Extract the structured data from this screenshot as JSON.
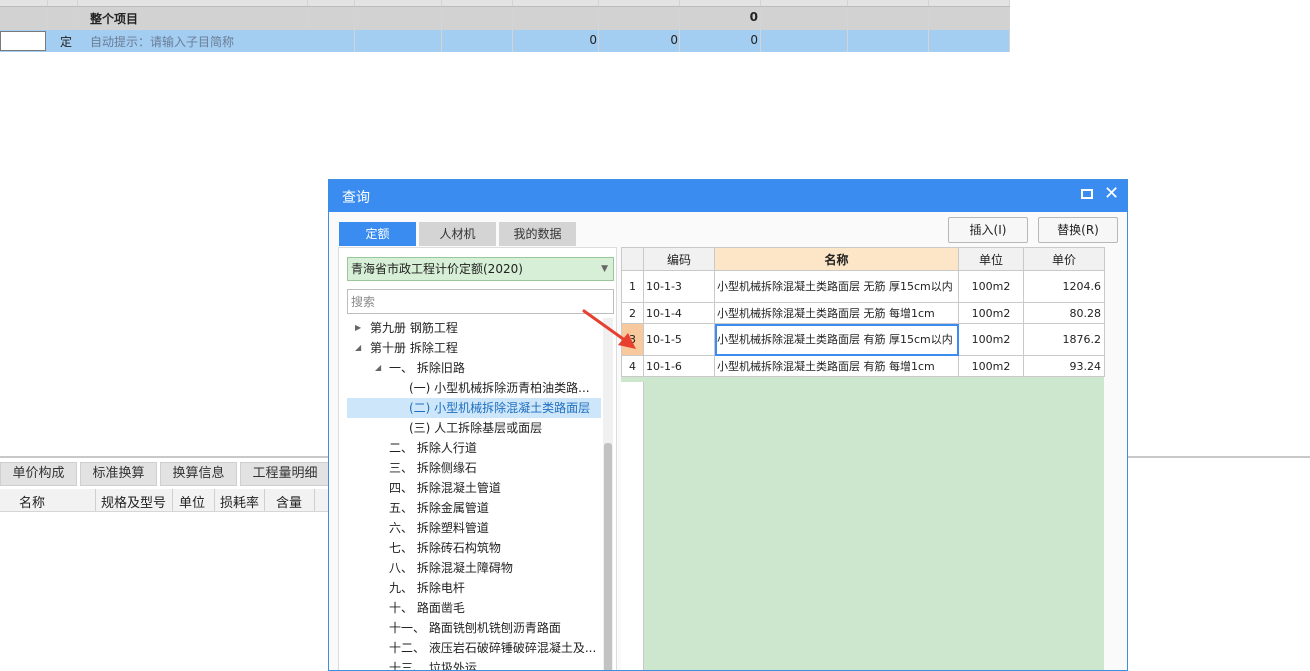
{
  "main_grid": {
    "total_row": {
      "label": "整个项目",
      "value": "0"
    },
    "input_row": {
      "type": "定",
      "hint": "自动提示：请输入子目简称",
      "v1": "0",
      "v2": "0",
      "v3": "0"
    }
  },
  "bottom_panel": {
    "tabs": [
      "单价构成",
      "标准换算",
      "换算信息",
      "工程量明细"
    ],
    "columns": [
      "名称",
      "规格及型号",
      "单位",
      "损耗率",
      "含量"
    ]
  },
  "dialog": {
    "title": "查询",
    "tabs": [
      "定额",
      "人材机",
      "我的数据"
    ],
    "insert_button": "插入(I)",
    "replace_button": "替换(R)",
    "library": "青海省市政工程计价定额(2020)",
    "search_placeholder": "搜索",
    "tree": [
      "第九册 钢筋工程",
      "第十册 拆除工程",
      "一、 拆除旧路",
      "(一) 小型机械拆除沥青柏油类路...",
      "(二) 小型机械拆除混凝土类路面层",
      "(三) 人工拆除基层或面层",
      "二、 拆除人行道",
      "三、 拆除侧缘石",
      "四、 拆除混凝土管道",
      "五、 拆除金属管道",
      "六、 拆除塑料管道",
      "七、 拆除砖石构筑物",
      "八、 拆除混凝土障碍物",
      "九、 拆除电杆",
      "十、 路面凿毛",
      "十一、 路面铣刨机铣刨沥青路面",
      "十二、 液压岩石破碎锤破碎混凝土及...",
      "十三、 垃圾外运"
    ],
    "table": {
      "headers": [
        "编码",
        "名称",
        "单位",
        "单价"
      ],
      "rows": [
        {
          "no": "1",
          "code": "10-1-3",
          "name": "小型机械拆除混凝土类路面层 无筋 厚15cm以内",
          "unit": "100m2",
          "price": "1204.6"
        },
        {
          "no": "2",
          "code": "10-1-4",
          "name": "小型机械拆除混凝土类路面层 无筋 每增1cm",
          "unit": "100m2",
          "price": "80.28"
        },
        {
          "no": "3",
          "code": "10-1-5",
          "name": "小型机械拆除混凝土类路面层 有筋 厚15cm以内",
          "unit": "100m2",
          "price": "1876.2"
        },
        {
          "no": "4",
          "code": "10-1-6",
          "name": "小型机械拆除混凝土类路面层 有筋 每增1cm",
          "unit": "100m2",
          "price": "93.24"
        }
      ]
    }
  },
  "colors": {
    "accent": "#3b8cf0",
    "selected_row": "#a4cdf2",
    "table_bg": "#cde7cf",
    "arrow": "#e8402f"
  }
}
